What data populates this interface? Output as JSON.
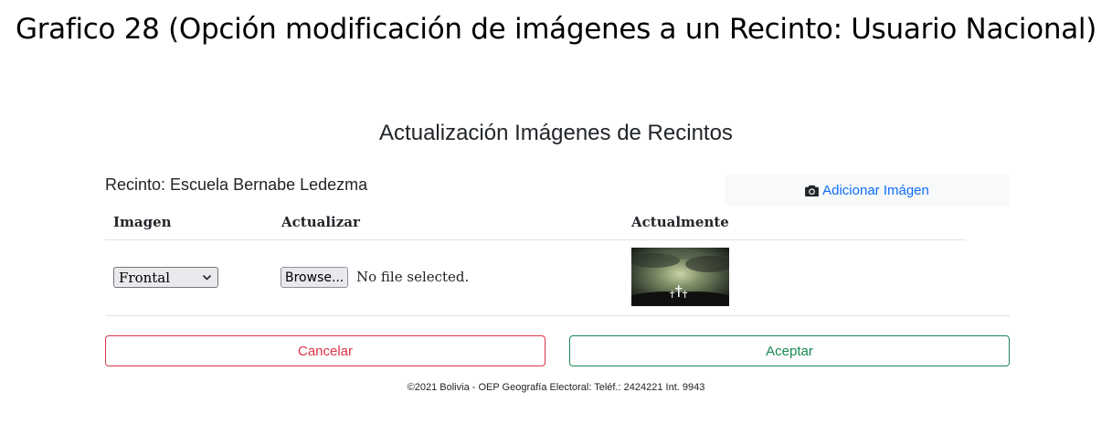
{
  "document": {
    "caption": "Grafico 28 (Opción modificación de imágenes a un Recinto: Usuario Nacional)"
  },
  "form": {
    "title": "Actualización Imágenes de Recintos",
    "recinto_label": "Recinto: Escuela Bernabe Ledezma",
    "add_image_label": "Adicionar Imágen",
    "add_image_icon": "camera-icon"
  },
  "table": {
    "headers": [
      "Imagen",
      "Actualizar",
      "Actualmente"
    ],
    "rows": [
      {
        "image_type": "Frontal",
        "browse_label": "Browse...",
        "file_status": "No file selected."
      }
    ]
  },
  "actions": {
    "cancel_label": "Cancelar",
    "accept_label": "Aceptar"
  },
  "footer": {
    "text": "©2021 Bolivia - OEP Geografía Electoral: Teléf.: 2424221 Int. 9943"
  },
  "colors": {
    "link": "#0d6efd",
    "danger": "#dc3545",
    "success": "#198754"
  }
}
